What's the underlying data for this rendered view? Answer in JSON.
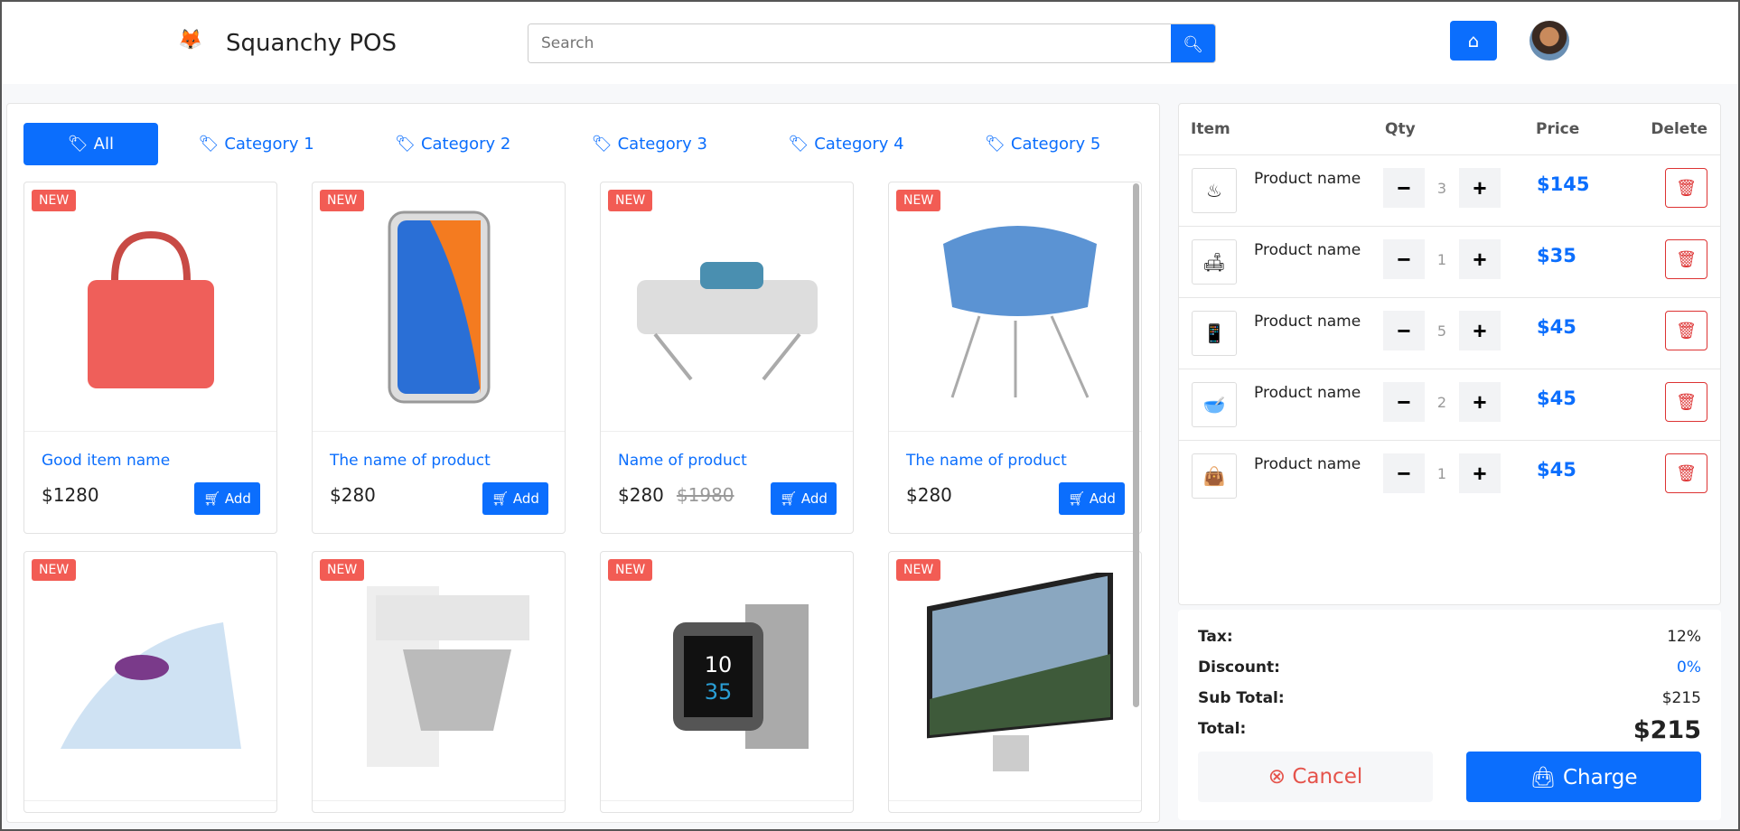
{
  "header": {
    "brand": "Squanchy POS",
    "search_placeholder": "Search"
  },
  "categories": [
    {
      "label": "All",
      "active": true
    },
    {
      "label": "Category 1"
    },
    {
      "label": "Category 2"
    },
    {
      "label": "Category 3"
    },
    {
      "label": "Category 4"
    },
    {
      "label": "Category 5"
    }
  ],
  "products": [
    {
      "badge": "NEW",
      "name": "Good item name",
      "price": "$1280",
      "old_price": "",
      "add": "Add",
      "image": "handbag"
    },
    {
      "badge": "NEW",
      "name": "The name of product",
      "price": "$280",
      "old_price": "",
      "add": "Add",
      "image": "phone"
    },
    {
      "badge": "NEW",
      "name": "Name of product",
      "price": "$280",
      "old_price": "$1980",
      "add": "Add",
      "image": "sofa"
    },
    {
      "badge": "NEW",
      "name": "The name of product",
      "price": "$280",
      "old_price": "",
      "add": "Add",
      "image": "chair"
    },
    {
      "badge": "NEW",
      "image": "iron"
    },
    {
      "badge": "NEW",
      "image": "mixer"
    },
    {
      "badge": "NEW",
      "image": "watch"
    },
    {
      "badge": "NEW",
      "image": "monitor"
    }
  ],
  "cart": {
    "headers": {
      "item": "Item",
      "qty": "Qty",
      "price": "Price",
      "delete": "Delete"
    },
    "items": [
      {
        "name": "Product name",
        "qty": "3",
        "price": "$145",
        "image": "iron"
      },
      {
        "name": "Product name",
        "qty": "1",
        "price": "$35",
        "image": "sofa"
      },
      {
        "name": "Product name",
        "qty": "5",
        "price": "$45",
        "image": "phone"
      },
      {
        "name": "Product name",
        "qty": "2",
        "price": "$45",
        "image": "mixer"
      },
      {
        "name": "Product name",
        "qty": "1",
        "price": "$45",
        "image": "handbag"
      }
    ]
  },
  "summary": {
    "tax_label": "Tax:",
    "tax": "12%",
    "discount_label": "Discount:",
    "discount": "0%",
    "subtotal_label": "Sub Total:",
    "subtotal": "$215",
    "total_label": "Total:",
    "total": "$215",
    "cancel": "Cancel",
    "charge": "Charge"
  },
  "colors": {
    "primary": "#0b6efd",
    "badge": "#f25c54",
    "danger": "#dd3333"
  }
}
